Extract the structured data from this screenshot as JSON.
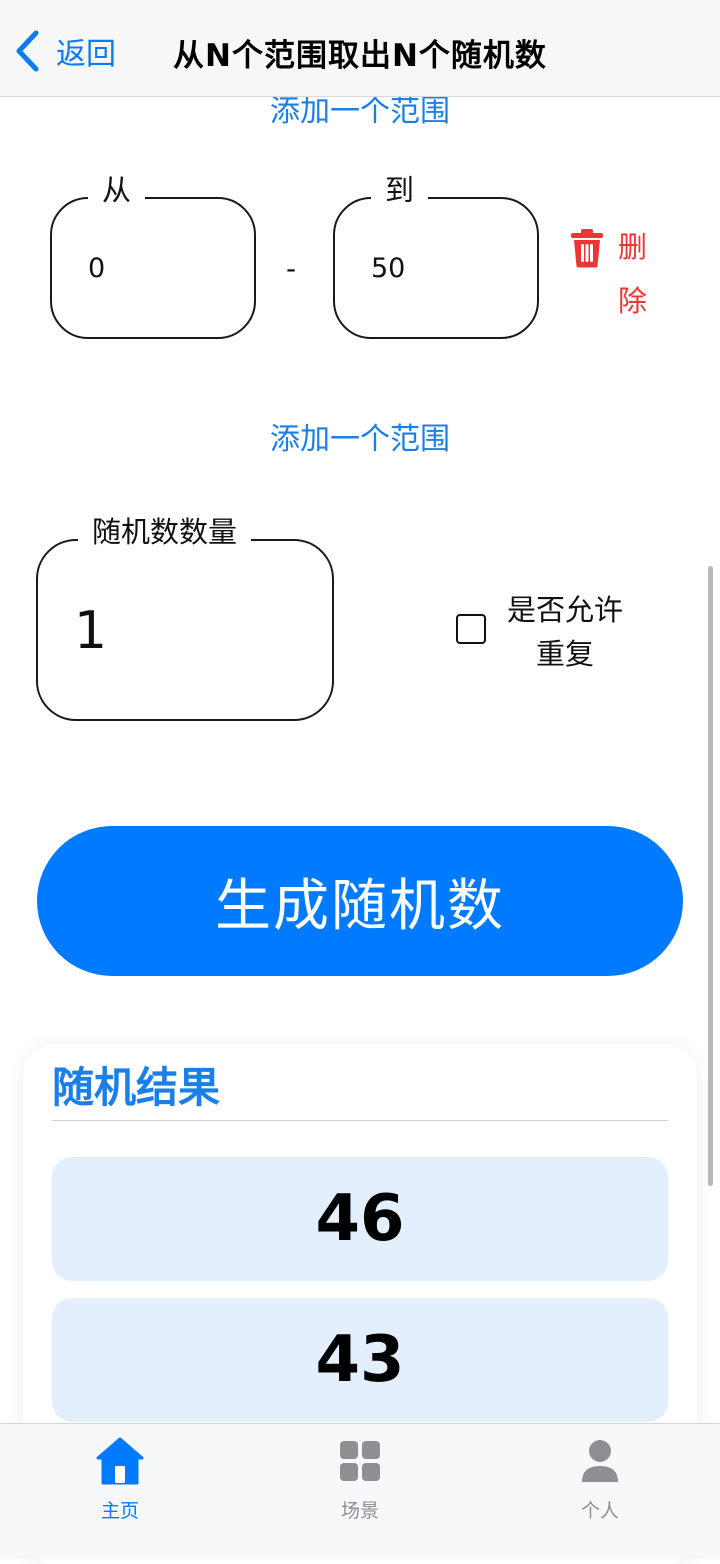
{
  "nav": {
    "back_label": "返回",
    "title": "从N个范围取出N个随机数"
  },
  "colors": {
    "accent": "#007aff",
    "link": "#1a7fe6",
    "delete": "#ee3535",
    "result_bg": "#e4effd",
    "tab_inactive": "#8e8e93"
  },
  "ranges": [
    {
      "from_label": "从",
      "from_value": "0",
      "separator": "-",
      "to_label": "到",
      "to_value": "50",
      "delete_label": "删除"
    }
  ],
  "add_range_label": "添加一个范围",
  "count": {
    "label": "随机数数量",
    "value": "1"
  },
  "allow_repeat": {
    "label": "是否允许重复",
    "checked": false
  },
  "generate_button": "生成随机数",
  "results": {
    "title": "随机结果",
    "items": [
      "46",
      "43"
    ]
  },
  "tabbar": {
    "items": [
      {
        "label": "主页",
        "icon": "home-icon",
        "active": true
      },
      {
        "label": "场景",
        "icon": "grid-icon",
        "active": false
      },
      {
        "label": "个人",
        "icon": "person-icon",
        "active": false
      }
    ]
  }
}
